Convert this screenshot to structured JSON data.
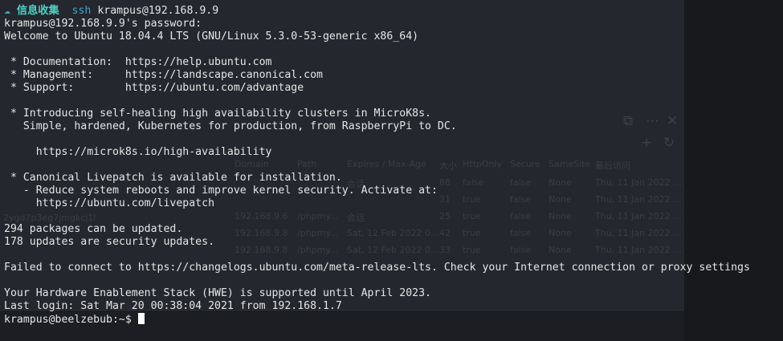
{
  "window": {
    "tab_icon": "cloud-icon",
    "tab_title": "信息收集",
    "command": "ssh",
    "command_arg": "krampus@192.168.9.9"
  },
  "terminal": {
    "lines": [
      "krampus@192.168.9.9's password:",
      "Welcome to Ubuntu 18.04.4 LTS (GNU/Linux 5.3.0-53-generic x86_64)",
      "",
      " * Documentation:  https://help.ubuntu.com",
      " * Management:     https://landscape.canonical.com",
      " * Support:        https://ubuntu.com/advantage",
      "",
      " * Introducing self-healing high availability clusters in MicroK8s.",
      "   Simple, hardened, Kubernetes for production, from RaspberryPi to DC.",
      "",
      "     https://microk8s.io/high-availability",
      "",
      " * Canonical Livepatch is available for installation.",
      "   - Reduce system reboots and improve kernel security. Activate at:",
      "     https://ubuntu.com/livepatch",
      "",
      "294 packages can be updated.",
      "178 updates are security updates.",
      "",
      "Failed to connect to https://changelogs.ubuntu.com/meta-release-lts. Check your Internet connection or proxy settings",
      "",
      "Your Hardware Enablement Stack (HWE) is supported until April 2023.",
      "Last login: Sat Mar 20 00:38:04 2021 from 192.168.1.7"
    ],
    "prompt": "krampus@beelzebub:~$ "
  },
  "background": {
    "table_headers": [
      "Domain",
      "Path",
      "Expires / Max-Age",
      "大小",
      "HttpOnly",
      "Secure",
      "SameSite",
      "最后访问"
    ],
    "rows": [
      [
        "",
        "",
        "会话",
        "88",
        "false",
        "false",
        "None",
        "Thu, 11 Jan 2022 ..."
      ],
      [
        "",
        "",
        "",
        "31",
        "true",
        "false",
        "None",
        "Thu, 11 Jan 2022 ..."
      ],
      [
        "192.168.9.6",
        "/phpmy...",
        "会话",
        "25",
        "true",
        "false",
        "None",
        "Thu, 11 Jan 2022 ..."
      ],
      [
        "192.168.9.8",
        "/phpmy...",
        "Sat, 12 Feb 2022 0...",
        "42",
        "true",
        "false",
        "None",
        "Thu, 11 Jan 2022 ..."
      ],
      [
        "192.168.9.8",
        "/phpmy...",
        "Sat, 12 Feb 2022 0...",
        "33",
        "true",
        "false",
        "None",
        "Thu, 11 Jan 2022 ..."
      ]
    ],
    "side_cookie_text": "2ygd7p3eg7jmgkcj1l"
  }
}
